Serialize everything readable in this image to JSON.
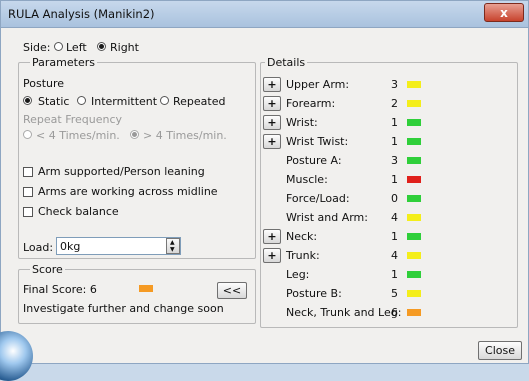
{
  "window": {
    "title": "RULA Analysis (Manikin2)",
    "close_glyph": "x",
    "close_button_label": "Close"
  },
  "side": {
    "label": "Side:",
    "options": [
      "Left",
      "Right"
    ],
    "selected": "Right"
  },
  "parameters": {
    "legend": "Parameters",
    "posture_label": "Posture",
    "posture_options": [
      "Static",
      "Intermittent",
      "Repeated"
    ],
    "posture_selected": "Static",
    "repeat_frequency_label": "Repeat Frequency",
    "repeat_options": [
      "< 4 Times/min.",
      "> 4 Times/min."
    ],
    "repeat_selected": "> 4 Times/min.",
    "checkboxes": [
      {
        "label": "Arm supported/Person leaning",
        "checked": false
      },
      {
        "label": "Arms are working across midline",
        "checked": false
      },
      {
        "label": "Check balance",
        "checked": false
      }
    ],
    "load_label": "Load:",
    "load_value": "0kg"
  },
  "score": {
    "legend": "Score",
    "final_score_label": "Final Score: 6",
    "final_score_color": "#f59a23",
    "collapse_button": "<<",
    "message": "Investigate further and change soon"
  },
  "details": {
    "legend": "Details",
    "rows": [
      {
        "label": "Upper Arm:",
        "value": "3",
        "color": "#f4ee1a",
        "expandable": true
      },
      {
        "label": "Forearm:",
        "value": "2",
        "color": "#f4ee1a",
        "expandable": true
      },
      {
        "label": "Wrist:",
        "value": "1",
        "color": "#2fcf3a",
        "expandable": true
      },
      {
        "label": "Wrist Twist:",
        "value": "1",
        "color": "#2fcf3a",
        "expandable": true
      },
      {
        "label": "Posture A:",
        "value": "3",
        "color": "#2fcf3a",
        "expandable": false
      },
      {
        "label": "Muscle:",
        "value": "1",
        "color": "#e0201b",
        "expandable": false
      },
      {
        "label": "Force/Load:",
        "value": "0",
        "color": "#2fcf3a",
        "expandable": false
      },
      {
        "label": "Wrist and Arm:",
        "value": "4",
        "color": "#f4ee1a",
        "expandable": false
      },
      {
        "label": "Neck:",
        "value": "1",
        "color": "#2fcf3a",
        "expandable": true
      },
      {
        "label": "Trunk:",
        "value": "4",
        "color": "#f4ee1a",
        "expandable": true
      },
      {
        "label": "Leg:",
        "value": "1",
        "color": "#2fcf3a",
        "expandable": false
      },
      {
        "label": "Posture B:",
        "value": "5",
        "color": "#f4ee1a",
        "expandable": false
      },
      {
        "label": "Neck, Trunk and Leg:",
        "value": "6",
        "color": "#f59a23",
        "expandable": false
      }
    ],
    "expand_glyph": "+"
  }
}
